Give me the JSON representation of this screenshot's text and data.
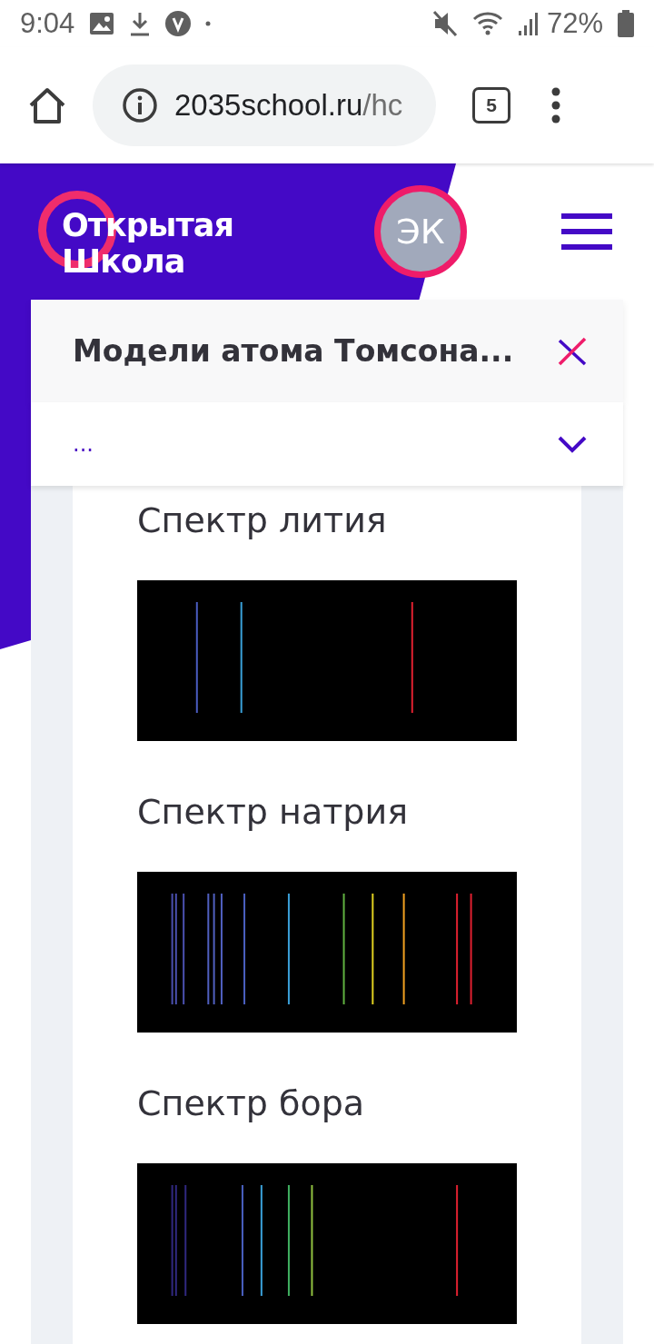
{
  "status_bar": {
    "time": "9:04",
    "battery": "72%"
  },
  "browser": {
    "url": {
      "domain": "2035school.ru",
      "path": "/hc"
    },
    "tab_count": "5"
  },
  "header": {
    "logo": [
      "Открытая",
      "Школа"
    ],
    "avatar": "ЭК"
  },
  "lesson_panel": {
    "title": "Модели атома Томсона...",
    "section_select": {
      "value": "..."
    }
  },
  "spectra": [
    {
      "heading": "Спектр лития"
    },
    {
      "heading": "Спектр натрия"
    },
    {
      "heading": "Спектр бора"
    }
  ]
}
